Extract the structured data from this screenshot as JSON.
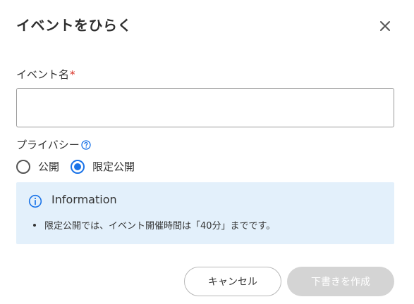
{
  "dialog": {
    "title": "イベントをひらく",
    "close_icon": "close-icon"
  },
  "event_name": {
    "label": "イベント名",
    "required_mark": "*",
    "value": "",
    "placeholder": ""
  },
  "privacy": {
    "label": "プライバシー",
    "help_icon": "question-circle-icon",
    "options": [
      {
        "label": "公開",
        "selected": false
      },
      {
        "label": "限定公開",
        "selected": true
      }
    ]
  },
  "info": {
    "icon": "info-icon",
    "title": "Information",
    "items": [
      "限定公開では、イベント開催時間は「40分」までです。"
    ]
  },
  "actions": {
    "cancel_label": "キャンセル",
    "create_label": "下書きを作成",
    "create_enabled": false
  },
  "colors": {
    "accent": "#1a73e8",
    "required": "#d93025",
    "info_background": "#e3f0fb",
    "disabled_button": "#d4d4d4"
  }
}
